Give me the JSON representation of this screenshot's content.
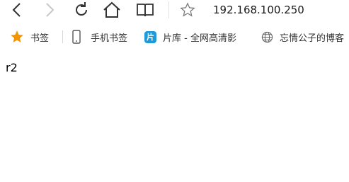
{
  "toolbar": {
    "back_icon": "back-icon",
    "forward_icon": "forward-icon",
    "reload_icon": "reload-icon",
    "home_icon": "home-icon",
    "reading_icon": "reading-view-icon",
    "favorite_icon": "star-outline-icon",
    "address": "192.168.100.250"
  },
  "bookmarks": {
    "items": [
      {
        "label": "书签",
        "icon": "star-icon",
        "icon_color": "#f29400"
      },
      {
        "label": "手机书签",
        "icon": "phone-icon"
      },
      {
        "label": "片库 - 全网高清影",
        "icon": "pianku-icon",
        "icon_text": "片",
        "icon_color": "#1e9bd7"
      },
      {
        "label": "忘情公子的博客",
        "icon": "globe-icon"
      }
    ]
  },
  "page": {
    "content": "r2"
  }
}
